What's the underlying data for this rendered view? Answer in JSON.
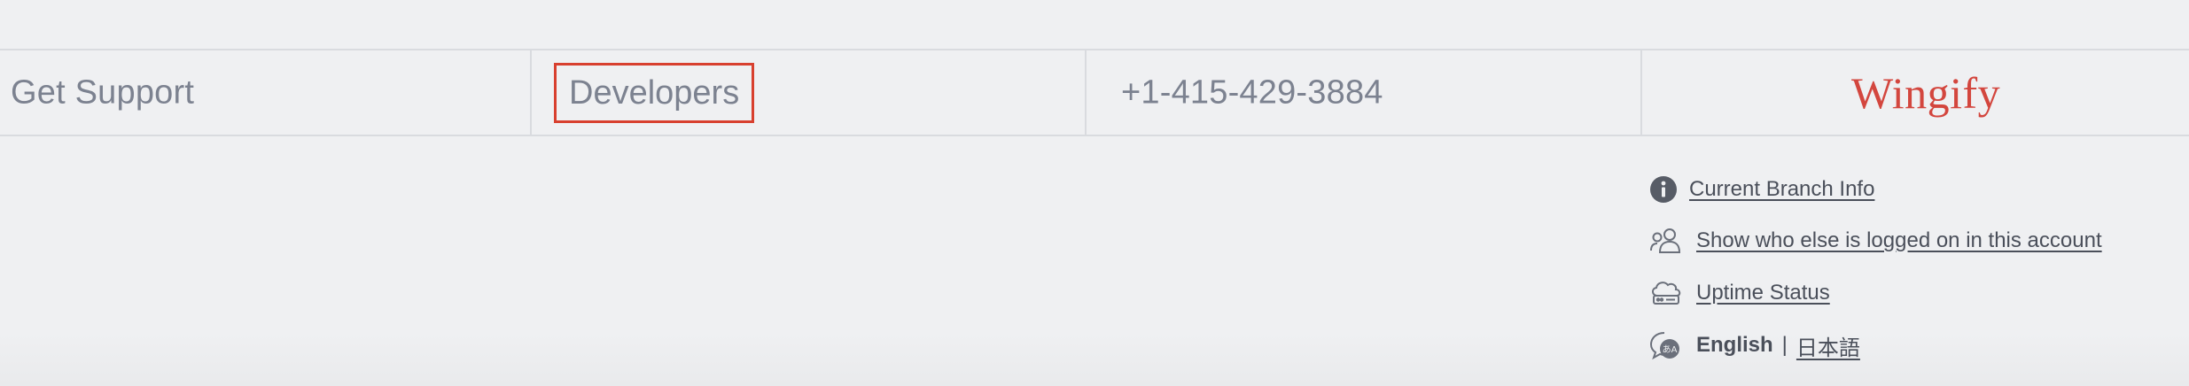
{
  "footer_nav": {
    "get_support": "Get Support",
    "developers": "Developers",
    "phone": "+1-415-429-3884",
    "brand": "Wingify"
  },
  "links": {
    "branch_info": "Current Branch Info",
    "logged_on": "Show who else is logged on in this account",
    "uptime": "Uptime Status"
  },
  "language": {
    "current": "English",
    "divider": "|",
    "other": "日本語"
  },
  "icons": {
    "branch_info": "info-circle-icon",
    "logged_on": "users-icon",
    "uptime": "cloud-server-icon",
    "language": "chat-language-icon"
  },
  "colors": {
    "brand": "#d3463e",
    "highlight_box": "#d8402f",
    "nav_text": "#7c8290",
    "link_text": "#4a4f5a",
    "background": "#eff0f2"
  }
}
